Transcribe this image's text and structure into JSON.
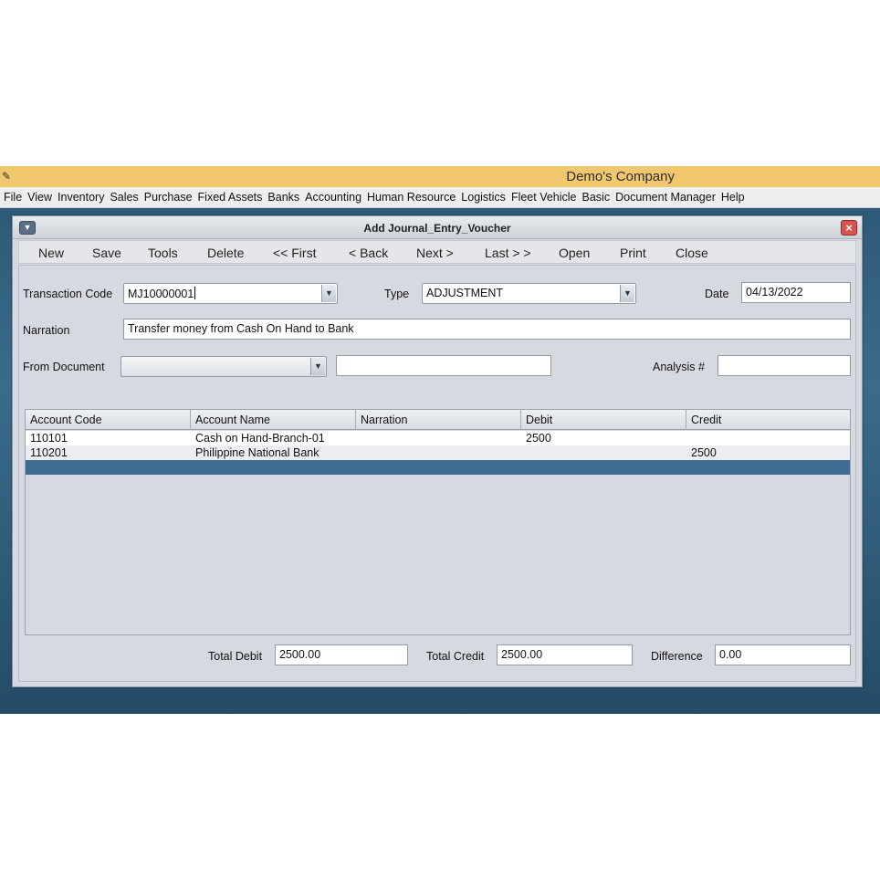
{
  "app": {
    "title": "Demo's Company"
  },
  "menu": [
    "File",
    "View",
    "Inventory",
    "Sales",
    "Purchase",
    "Fixed Assets",
    "Banks",
    "Accounting",
    "Human Resource",
    "Logistics",
    "Fleet Vehicle",
    "Basic",
    "Document Manager",
    "Help"
  ],
  "window": {
    "title": "Add Journal_Entry_Voucher"
  },
  "toolbar": {
    "new": "New",
    "save": "Save",
    "tools": "Tools",
    "delete": "Delete",
    "first": "<< First",
    "back": "< Back",
    "next": "Next >",
    "last": "Last > >",
    "open": "Open",
    "print": "Print",
    "close": "Close"
  },
  "form": {
    "transaction_code_label": "Transaction Code",
    "transaction_code_value": "MJ10000001",
    "type_label": "Type",
    "type_value": "ADJUSTMENT",
    "date_label": "Date",
    "date_value": "04/13/2022",
    "narration_label": "Narration",
    "narration_value": "Transfer money from Cash On Hand to Bank",
    "from_document_label": "From Document",
    "from_document_value": "",
    "from_document_text": "",
    "analysis_label": "Analysis #",
    "analysis_value": ""
  },
  "grid": {
    "columns": [
      "Account Code",
      "Account Name",
      "Narration",
      "Debit",
      "Credit"
    ],
    "rows": [
      {
        "account_code": "110101",
        "account_name": "Cash on Hand-Branch-01",
        "narration": "",
        "debit": "2500",
        "credit": ""
      },
      {
        "account_code": "110201",
        "account_name": "Philippine National Bank",
        "narration": "",
        "debit": "",
        "credit": "2500"
      }
    ]
  },
  "totals": {
    "total_debit_label": "Total Debit",
    "total_debit_value": "2500.00",
    "total_credit_label": "Total Credit",
    "total_credit_value": "2500.00",
    "difference_label": "Difference",
    "difference_value": "0.00"
  },
  "colors": {
    "titlebar": "#f2c86e",
    "desktop": "#2e5a78",
    "selection": "#3d6b91",
    "window": "#d6dae0"
  },
  "icons": {
    "app": "app-logo-icon",
    "window_menu": "window-menu-icon",
    "window_close": "close-icon",
    "dropdown": "chevron-down-icon"
  }
}
